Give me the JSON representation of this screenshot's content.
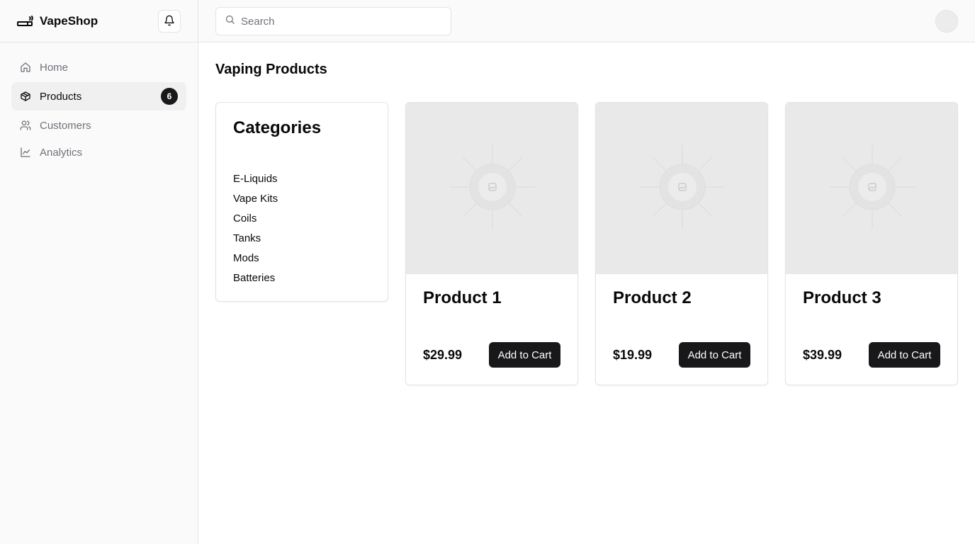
{
  "brand": {
    "name": "VapeShop",
    "logo_icon": "vape-icon"
  },
  "header": {
    "search": {
      "placeholder": "Search",
      "value": ""
    },
    "notification_icon": "bell-icon"
  },
  "sidebar": {
    "items": [
      {
        "label": "Home",
        "icon": "home-icon",
        "active": false
      },
      {
        "label": "Products",
        "icon": "package-icon",
        "active": true,
        "badge": "6"
      },
      {
        "label": "Customers",
        "icon": "users-icon",
        "active": false
      },
      {
        "label": "Analytics",
        "icon": "line-chart-icon",
        "active": false
      }
    ]
  },
  "main": {
    "title": "Vaping Products",
    "categories": {
      "title": "Categories",
      "items": [
        "E-Liquids",
        "Vape Kits",
        "Coils",
        "Tanks",
        "Mods",
        "Batteries"
      ]
    },
    "products": [
      {
        "name": "Product 1",
        "price": "$29.99",
        "button": "Add to Cart"
      },
      {
        "name": "Product 2",
        "price": "$19.99",
        "button": "Add to Cart"
      },
      {
        "name": "Product 3",
        "price": "$39.99",
        "button": "Add to Cart"
      }
    ]
  },
  "colors": {
    "accent": "#18181b",
    "sidebar_bg": "#fafafa",
    "border": "#e4e4e7",
    "muted_text": "#71717a",
    "image_placeholder": "#e9e9e9"
  }
}
